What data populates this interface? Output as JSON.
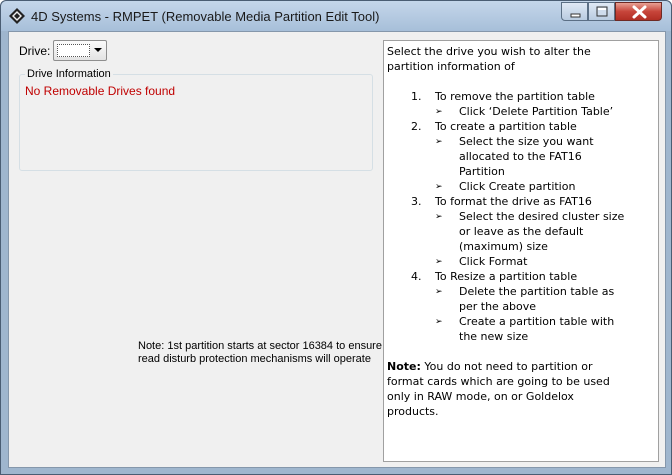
{
  "window": {
    "title": "4D Systems - RMPET (Removable Media Partition Edit Tool)",
    "icons": {
      "app": "4d-systems-logo-icon",
      "minimize": "minimize-icon",
      "maximize": "maximize-icon",
      "close": "close-icon"
    }
  },
  "drive": {
    "label": "Drive:",
    "selected_value": ""
  },
  "drive_info": {
    "title": "Drive Information",
    "status": "No Removable Drives found",
    "status_color": "#c00000"
  },
  "note_left": "Note: 1st partition starts at sector 16384 to ensure read disturb protection mechanisms will operate",
  "instructions": {
    "intro_line1": "Select the drive you wish to alter the",
    "intro_line2": "partition information of",
    "items": [
      {
        "num": "1.",
        "text": "To remove the partition table",
        "sub": [
          {
            "lines": [
              "Click ‘Delete Partition Table’"
            ]
          }
        ]
      },
      {
        "num": "2.",
        "text": "To create a partition table",
        "sub": [
          {
            "lines": [
              "Select the size you want",
              "allocated to the FAT16",
              "Partition"
            ]
          },
          {
            "lines": [
              "Click Create partition"
            ]
          }
        ]
      },
      {
        "num": "3.",
        "text": "To format the drive as FAT16",
        "sub": [
          {
            "lines": [
              "Select the desired cluster size",
              "or leave as the default",
              "(maximum) size"
            ]
          },
          {
            "lines": [
              "Click Format"
            ]
          }
        ]
      },
      {
        "num": "4.",
        "text": "To Resize a partition table",
        "sub": [
          {
            "lines": [
              "Delete the partition table as",
              "per the above"
            ]
          },
          {
            "lines": [
              "Create a partition table with",
              "the new size"
            ]
          }
        ]
      }
    ],
    "note_bold": "Note:",
    "note_line1": " You do not need to partition or",
    "note_line2": "format cards which are going to be used",
    "note_line3": "only in RAW mode, on or Goldelox",
    "note_line4": "products.",
    "arrow_glyph": "➢"
  }
}
